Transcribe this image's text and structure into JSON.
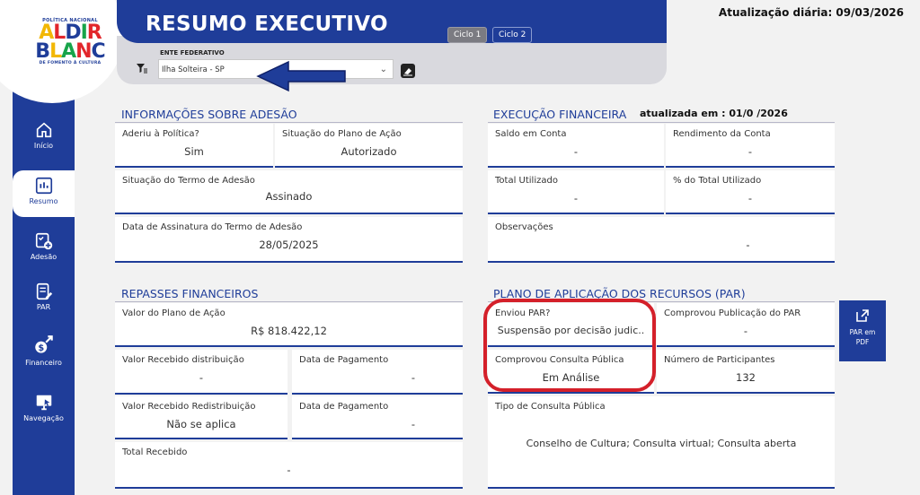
{
  "logo": {
    "top": "POLÍTICA NACIONAL",
    "line1": "ALDIR",
    "line2": "BLANC",
    "bottom": "DE FOMENTO À CULTURA"
  },
  "header": {
    "title": "RESUMO EXECUTIVO",
    "update_label": "Atualização diária: 09/03/2026"
  },
  "cycles": [
    {
      "label": "Ciclo 1"
    },
    {
      "label": "Ciclo 2"
    }
  ],
  "filter": {
    "label": "ENTE FEDERATIVO",
    "value": "Ilha Solteira - SP"
  },
  "nav": [
    {
      "label": "Início",
      "icon": "home-icon"
    },
    {
      "label": "Resumo",
      "icon": "dashboard-icon"
    },
    {
      "label": "Adesão",
      "icon": "checklist-add-icon"
    },
    {
      "label": "PAR",
      "icon": "document-edit-icon"
    },
    {
      "label": "Financeiro",
      "icon": "money-growth-icon"
    },
    {
      "label": "Navegação",
      "icon": "monitor-pointer-icon"
    }
  ],
  "adesao": {
    "title": "INFORMAÇÕES SOBRE ADESÃO",
    "aderiu": {
      "label": "Aderiu à Política?",
      "value": "Sim"
    },
    "situacao_plano": {
      "label": "Situação do Plano de Ação",
      "value": "Autorizado"
    },
    "situacao_termo": {
      "label": "Situação do Termo de Adesão",
      "value": "Assinado"
    },
    "data_assinatura": {
      "label": "Data de Assinatura do Termo de Adesão",
      "value": "28/05/2025"
    }
  },
  "execucao": {
    "title": "EXECUÇÃO FINANCEIRA",
    "updated": "atualizada em : 01/0 /2026",
    "saldo": {
      "label": "Saldo em Conta",
      "value": "-"
    },
    "rendimento": {
      "label": "Rendimento da Conta",
      "value": "-"
    },
    "total_utilizado": {
      "label": "Total Utilizado",
      "value": "-"
    },
    "pct_utilizado": {
      "label": "% do Total Utilizado",
      "value": "-"
    },
    "observacoes": {
      "label": "Observações",
      "value": "-"
    }
  },
  "repasses": {
    "title": "REPASSES FINANCEIROS",
    "valor_plano": {
      "label": "Valor do Plano de Ação",
      "value": "R$ 818.422,12"
    },
    "recebido_distribuicao": {
      "label": "Valor Recebido distribuição",
      "value": "-"
    },
    "data_pag1": {
      "label": "Data de Pagamento",
      "value": "-"
    },
    "recebido_redistribuicao": {
      "label": "Valor Recebido Redistribuição",
      "value": "Não se aplica"
    },
    "data_pag2": {
      "label": "Data de Pagamento",
      "value": "-"
    },
    "total_recebido": {
      "label": "Total Recebido",
      "value": "-"
    }
  },
  "par": {
    "title": "PLANO DE APLICAÇÃO DOS RECURSOS (PAR)",
    "enviou": {
      "label": "Enviou PAR?",
      "value": "Suspensão por decisão judic.."
    },
    "comprovou_publicacao": {
      "label": "Comprovou Publicação do PAR",
      "value": "-"
    },
    "consulta_publica": {
      "label": "Comprovou Consulta Pública",
      "value": "Em Análise"
    },
    "participantes": {
      "label": "Número de Participantes",
      "value": "132"
    },
    "tipo_consulta": {
      "label": "Tipo de Consulta Pública",
      "value": "Conselho de Cultura; Consulta virtual; Consulta aberta"
    },
    "pdf_button": "PAR em PDF"
  },
  "colors": {
    "primary": "#1f3d99",
    "highlight": "#d4202a",
    "panel": "#d9d9de"
  }
}
